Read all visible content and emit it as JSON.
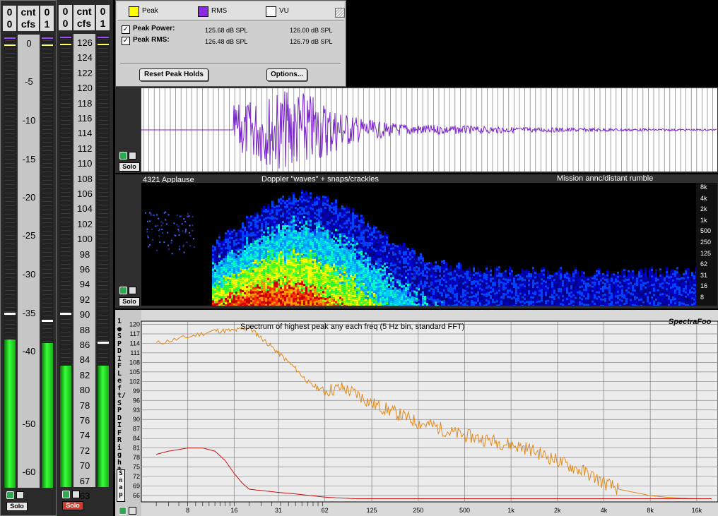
{
  "legend": {
    "items": [
      {
        "label": "Peak",
        "color": "#ffff00"
      },
      {
        "label": "RMS",
        "color": "#8a2be2"
      },
      {
        "label": "VU",
        "color": "#ffffff"
      }
    ]
  },
  "peak_panel": {
    "rows": [
      {
        "label": "Peak Power:",
        "left": "125.68 dB SPL",
        "right": "126.00 dB SPL",
        "checked": true
      },
      {
        "label": "Peak RMS:",
        "left": "126.48 dB SPL",
        "right": "126.79 dB SPL",
        "checked": true
      }
    ],
    "reset_label": "Reset Peak Holds",
    "options_label": "Options..."
  },
  "meter1": {
    "header": {
      "ch0_top": "0",
      "ch0_bot": "0",
      "unit_top": "cnt",
      "unit_bot": "cfs",
      "ch1_top": "0",
      "ch1_bot": "1"
    },
    "scale": [
      "0",
      "-5",
      "-10",
      "-15",
      "-20",
      "-25",
      "-30",
      "-35",
      "-40",
      "-50",
      "-60"
    ],
    "solo": "Solo"
  },
  "meter2": {
    "header": {
      "ch0_top": "0",
      "ch0_bot": "0",
      "unit_top": "cnt",
      "unit_bot": "cfs",
      "ch1_top": "0",
      "ch1_bot": "1"
    },
    "scale": [
      "126",
      "124",
      "122",
      "120",
      "118",
      "116",
      "114",
      "112",
      "110",
      "108",
      "106",
      "104",
      "102",
      "100",
      "98",
      "96",
      "94",
      "92",
      "90",
      "88",
      "86",
      "84",
      "82",
      "80",
      "78",
      "76",
      "74",
      "72",
      "70",
      "67",
      "63"
    ],
    "solo": "Solo"
  },
  "waveform": {
    "solo": "Solo"
  },
  "spectrogram": {
    "labels": [
      "4321 Applause",
      "Doppler \"waves\" + snaps/crackles",
      "Mission annc/distant rumble"
    ],
    "freq_ticks": [
      "8k",
      "4k",
      "2k",
      "1k",
      "500",
      "250",
      "125",
      "62",
      "31",
      "16",
      "8"
    ],
    "solo": "Solo"
  },
  "spectrum": {
    "title": "Spectrum of highest peak any each freq (5 Hz bin, standard FFT)",
    "brand": "SpectraFoo",
    "side_label": "1 ●SPDIF Left/SPDIF Right",
    "snap_label": "Snap",
    "icon": "spectrum-icon"
  },
  "chart_data": {
    "type": "line",
    "title": "Spectrum of highest peak any each freq (5 Hz bin, standard FFT)",
    "xlabel": "",
    "ylabel": "",
    "x_scale": "log",
    "x_ticks": [
      "8",
      "16",
      "31",
      "62",
      "125",
      "250",
      "500",
      "1k",
      "2k",
      "4k",
      "8k",
      "16k"
    ],
    "y_ticks": [
      "120",
      "117",
      "114",
      "111",
      "108",
      "105",
      "102",
      "99",
      "96",
      "93",
      "90",
      "87",
      "84",
      "81",
      "78",
      "75",
      "72",
      "69",
      "66"
    ],
    "ylim": [
      64,
      121
    ],
    "series": [
      {
        "color": "#e08a1e",
        "x": [
          5,
          8,
          12,
          16,
          20,
          25,
          31,
          40,
          50,
          62,
          80,
          100,
          125,
          160,
          200,
          250,
          315,
          400,
          500,
          630,
          800,
          1000,
          1250,
          1600,
          2000,
          2500,
          3150,
          4000,
          5000,
          6300,
          8000,
          10000,
          12500,
          16000,
          20000
        ],
        "y": [
          114,
          116,
          118,
          118,
          119,
          115,
          111,
          106,
          101,
          99,
          100,
          98,
          95,
          93,
          91,
          89,
          88,
          86,
          85,
          84,
          83,
          82,
          81,
          79,
          77,
          75,
          73,
          70,
          68,
          67,
          66,
          65.5,
          65.2,
          65,
          65
        ]
      },
      {
        "color": "#cc1111",
        "x": [
          5,
          6,
          7,
          8,
          10,
          12,
          14,
          16,
          18,
          20,
          25,
          31,
          40,
          50,
          62,
          80,
          100,
          160,
          300,
          1000,
          5000,
          20000
        ],
        "y": [
          79,
          80,
          80.5,
          81,
          81,
          80,
          77,
          73,
          70,
          68,
          67.5,
          67,
          66.5,
          66,
          65.5,
          65.2,
          65,
          65,
          65,
          65,
          65,
          65
        ]
      }
    ]
  }
}
